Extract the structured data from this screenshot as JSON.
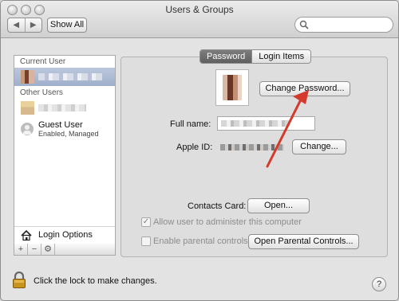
{
  "window": {
    "title": "Users & Groups"
  },
  "toolbar": {
    "back_icon": "◀",
    "forward_icon": "▶",
    "show_all_label": "Show All",
    "search_placeholder": ""
  },
  "sidebar": {
    "current_user_label": "Current User",
    "other_users_label": "Other Users",
    "guest_user_name": "Guest User",
    "guest_user_status": "Enabled, Managed",
    "login_options_label": "Login Options",
    "tools": [
      "+",
      "−",
      "⚙"
    ]
  },
  "tabs": [
    {
      "label": "Password",
      "active": true
    },
    {
      "label": "Login Items",
      "active": false
    }
  ],
  "panel": {
    "change_password_label": "Change Password...",
    "full_name_label": "Full name:",
    "apple_id_label": "Apple ID:",
    "change_apple_id_label": "Change...",
    "contacts_card_label": "Contacts Card:",
    "open_label": "Open...",
    "admin_checkbox_label": "Allow user to administer this computer",
    "admin_checked": true,
    "parental_checkbox_label": "Enable parental controls",
    "parental_checked": false,
    "open_parental_label": "Open Parental Controls..."
  },
  "footer": {
    "lock_text": "Click the lock to make changes.",
    "help_label": "?"
  },
  "colors": {
    "annotation_arrow": "#d33a2c",
    "selected_row": "#a8b5cf",
    "active_tab": "#6b6b6b"
  }
}
